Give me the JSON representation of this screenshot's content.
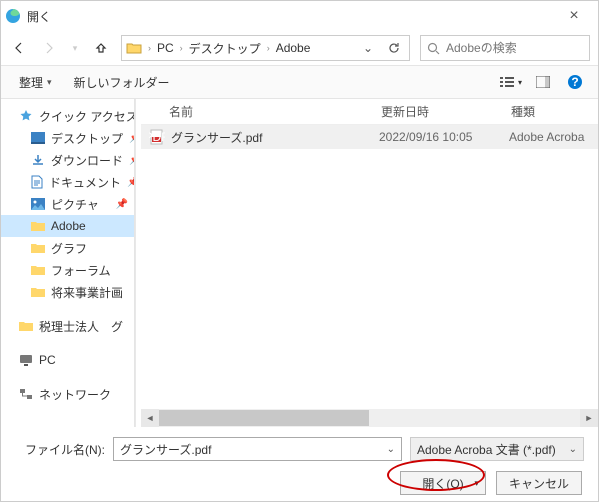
{
  "window": {
    "title": "開く"
  },
  "nav": {
    "breadcrumb": [
      "PC",
      "デスクトップ",
      "Adobe"
    ],
    "search_placeholder": "Adobeの検索"
  },
  "toolbar": {
    "organize": "整理",
    "new_folder": "新しいフォルダー"
  },
  "sidebar": {
    "quick_access": "クイック アクセス",
    "items": [
      {
        "label": "デスクトップ",
        "pin": true
      },
      {
        "label": "ダウンロード",
        "pin": true
      },
      {
        "label": "ドキュメント",
        "pin": true
      },
      {
        "label": "ピクチャ",
        "pin": true
      },
      {
        "label": "Adobe",
        "selected": true
      },
      {
        "label": "グラフ"
      },
      {
        "label": "フォーラム"
      },
      {
        "label": "将来事業計画"
      }
    ],
    "extra": "税理士法人　グ",
    "pc": "PC",
    "network": "ネットワーク"
  },
  "columns": {
    "name": "名前",
    "date": "更新日時",
    "type": "種類"
  },
  "files": [
    {
      "name": "グランサーズ.pdf",
      "date": "2022/09/16 10:05",
      "type": "Adobe Acroba"
    }
  ],
  "footer": {
    "filename_label": "ファイル名(N):",
    "filename_value": "グランサーズ.pdf",
    "filter": "Adobe Acroba 文書 (*.pdf)",
    "open": "開く(O)",
    "cancel": "キャンセル"
  }
}
